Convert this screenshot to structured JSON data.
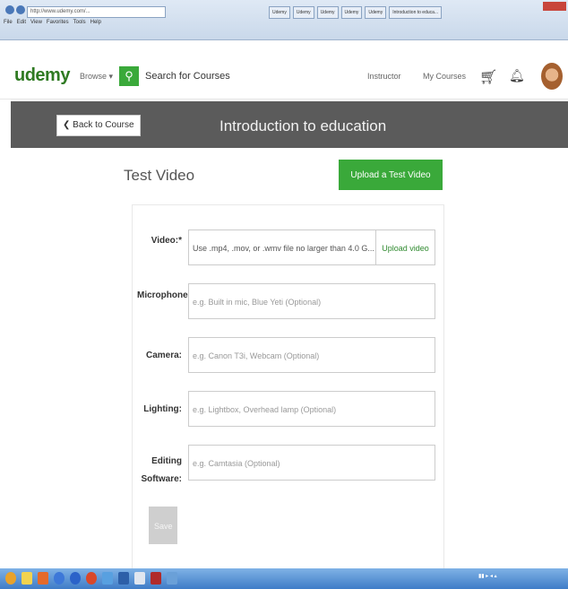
{
  "browser": {
    "address": "http://www.udemy.com/...",
    "menu": [
      "File",
      "Edit",
      "View",
      "Favorites",
      "Tools",
      "Help"
    ],
    "tabs": [
      "Udemy",
      "Udemy",
      "Udemy",
      "Udemy",
      "Udemy",
      "Introduction to educa..."
    ]
  },
  "header": {
    "logo": "udemy",
    "browse": "Browse ▾",
    "search_placeholder": "Search for Courses",
    "instructor": "Instructor",
    "my_courses": "My Courses"
  },
  "course_bar": {
    "back_label": "❮ Back to Course",
    "title": "Introduction to education"
  },
  "section": {
    "title": "Test Video",
    "upload_test_label": "Upload a Test Video"
  },
  "form": {
    "video_label": "Video:*",
    "video_value": "Use .mp4, .mov, or .wmv file no larger than 4.0 G...",
    "upload_video_label": "Upload video",
    "microphone_label": "Microphone:",
    "microphone_placeholder": "e.g. Built in mic, Blue Yeti (Optional)",
    "camera_label": "Camera:",
    "camera_placeholder": "e.g. Canon T3i, Webcam (Optional)",
    "lighting_label": "Lighting:",
    "lighting_placeholder": "e.g. Lightbox, Overhead lamp (Optional)",
    "editing_label_1": "Editing",
    "editing_label_2": "Software:",
    "editing_placeholder": "e.g. Camtasia (Optional)",
    "save_label": "Save"
  },
  "colors": {
    "brand_green": "#3aa93a",
    "course_bar": "#5b5b5b"
  }
}
